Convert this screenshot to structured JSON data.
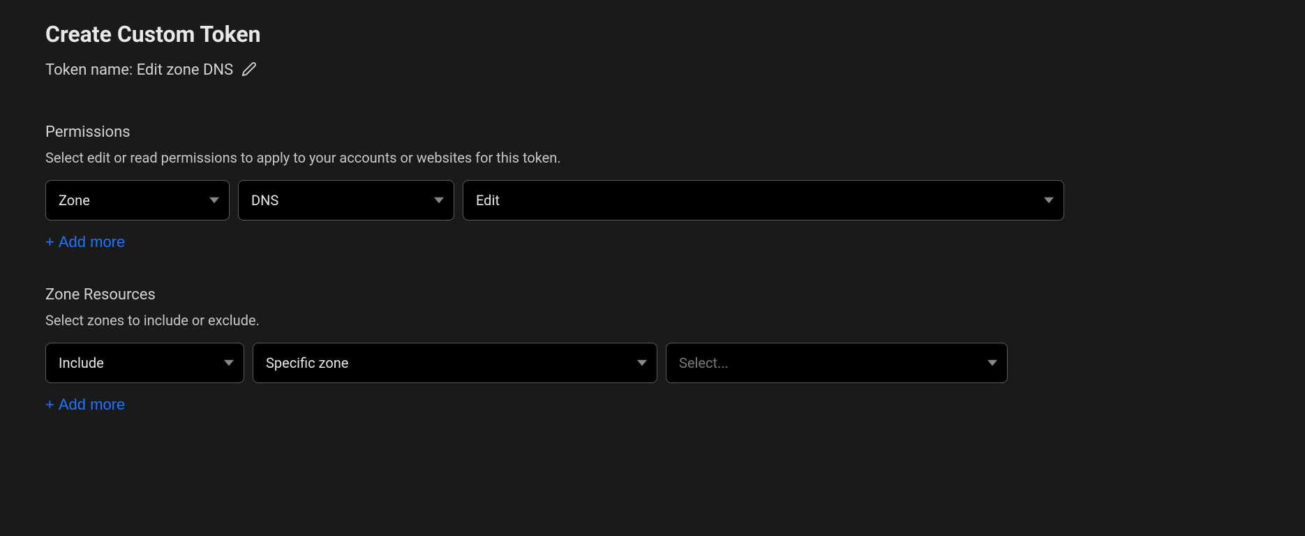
{
  "header": {
    "title": "Create Custom Token",
    "token_name_prefix": "Token name: ",
    "token_name_value": "Edit zone DNS"
  },
  "permissions": {
    "heading": "Permissions",
    "description": "Select edit or read permissions to apply to your accounts or websites for this token.",
    "rows": [
      {
        "scope": "Zone",
        "service": "DNS",
        "access": "Edit"
      }
    ],
    "add_more": "Add more"
  },
  "zone_resources": {
    "heading": "Zone Resources",
    "description": "Select zones to include or exclude.",
    "rows": [
      {
        "mode": "Include",
        "type": "Specific zone",
        "zone": "",
        "zone_placeholder": "Select..."
      }
    ],
    "add_more": "Add more"
  },
  "colors": {
    "background": "#1a1a1a",
    "select_bg": "#000000",
    "border": "#5a5a5a",
    "text": "#d4d4d4",
    "link": "#1f74ff"
  }
}
